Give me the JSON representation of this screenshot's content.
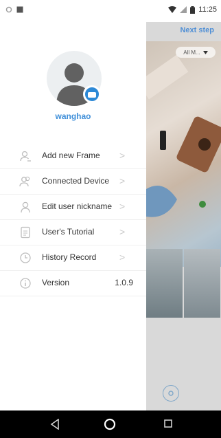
{
  "status_bar": {
    "time": "11:25"
  },
  "drawer": {
    "username": "wanghao",
    "menu": [
      {
        "label": "Add new Frame"
      },
      {
        "label": "Connected Device"
      },
      {
        "label": "Edit user nickname"
      },
      {
        "label": "User's Tutorial"
      },
      {
        "label": "History Record"
      },
      {
        "label": "Version",
        "value": "1.0.9"
      }
    ]
  },
  "content": {
    "next_step": "Next step",
    "album_select": "All M..."
  },
  "colors": {
    "accent": "#3f8fd9",
    "badge": "#2d89d6",
    "menu_icon": "#bdbdbd"
  }
}
